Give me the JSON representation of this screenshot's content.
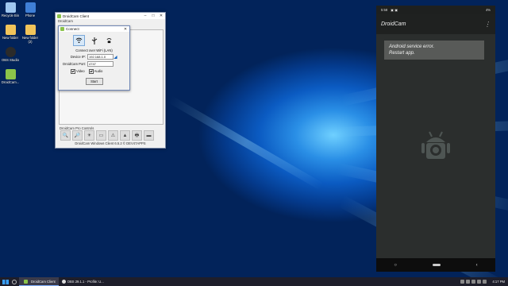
{
  "desktop": {
    "icons": [
      {
        "label": "Recycle Bin",
        "color": "#9fc7ef"
      },
      {
        "label": "Phone",
        "color": "#3f7fd6"
      },
      {
        "label": "New folder",
        "color": "#f1c45a"
      },
      {
        "label": "New folder (2)",
        "color": "#f1c45a"
      },
      {
        "label": "OBS Studio",
        "color": "#2b2b2b"
      },
      {
        "label": "DroidCam...",
        "color": "#8bc34a"
      }
    ]
  },
  "client": {
    "title": "DroidCam Client",
    "menu": "DroidCam",
    "pro_label": "DroidCam Pro Controls",
    "footer": "DroidCam Windows Client 6.5.2 © DEV47APPS",
    "tools": [
      "🔍",
      "🔎",
      "☀",
      "▭",
      "⚠",
      "▲",
      "🖶",
      "▬"
    ]
  },
  "connect": {
    "title": "Connect",
    "heading": "Connect over WiFi (LAN)",
    "ip_label": "Device IP:",
    "ip_value": "192.168.1.0",
    "port_label": "DroidCam Port:",
    "port_value": "4747",
    "video_label": "Video",
    "audio_label": "Audio",
    "start_label": "Start"
  },
  "phone": {
    "time": "5:58",
    "battery": "4%",
    "app_title": "DroidCam",
    "error_line1": "Android service error.",
    "error_line2": "Restart app."
  },
  "taskbar": {
    "item1": "DroidCam Client",
    "item2": "OBS 29.1.1 - Profile: U...",
    "clock": "4:17 PM"
  }
}
